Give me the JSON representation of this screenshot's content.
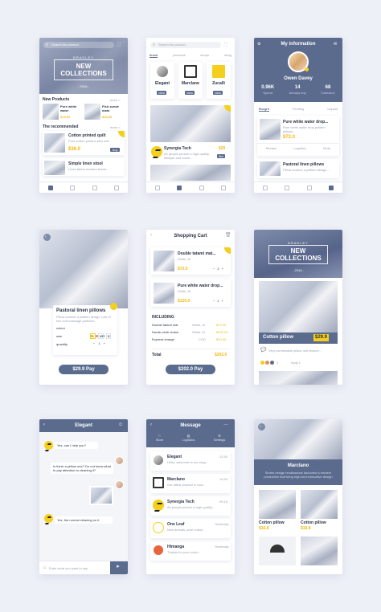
{
  "s1": {
    "search_placeholder": "Search the product",
    "brand": "BRADLEY",
    "collection_line1": "NEW",
    "collection_line2": "COLLECTIONS",
    "year": "- 2016 -",
    "new_products": "New Products",
    "more": "more >",
    "p1_name": "Pure white water",
    "p1_price": "$74.00",
    "p2_name": "Fish suede mats",
    "p2_price": "$12.00",
    "recommended": "The recommended",
    "r1_name": "Cotton printed quilt",
    "r1_desc": "Pure cotton printed ultra soft...",
    "r1_price": "$36.0",
    "r1_buy": "buy",
    "r2_name": "Simple linen stool",
    "r2_desc": "Linen fabric wooden frame..."
  },
  "s2": {
    "search_placeholder": "Search the product",
    "tabs": [
      "brand",
      "personal",
      "shops",
      "living"
    ],
    "b1": "Elegant",
    "b2": "Marclano",
    "b3": "Zucalli",
    "view": "view",
    "shop_name": "Synergia Tech",
    "shop_desc": "As people pursue a high-quality lifestyle and home...",
    "shop_price": "$20",
    "shop_btn": "like"
  },
  "s3": {
    "title": "My information",
    "name": "Owen Davey",
    "stat1_val": "0.96K",
    "stat1_lbl": "Spend",
    "stat2_val": "14",
    "stat2_lbl": "Already buy",
    "stat3_val": "68",
    "stat3_lbl": "Collection",
    "tabs": [
      "Bought",
      "Pending",
      "Unpaid"
    ],
    "o1_name": "Pure white water drop...",
    "o1_desc": "Pure white water drop pattern pillows...",
    "o1_price": "$72.0",
    "o1_actions": [
      "Review",
      "Logistics",
      "More"
    ],
    "o2_name": "Pastoral linen pillows",
    "o2_desc": "Pillow surface a pattern design..."
  },
  "s4": {
    "name": "Pastoral linen pillows",
    "desc": "Pillow surface a pattern design Lots of fine soft massage particles",
    "colour": "colour",
    "size": "size",
    "quantity": "quantity",
    "sizes": [
      "S",
      "M",
      "L"
    ],
    "qty": "1",
    "pay": "$29.9 Pay"
  },
  "s5": {
    "title": "Shopping Cart",
    "i1_name": "Double tatami mat...",
    "i1_sub": "White, M",
    "i1_price": "$72.0",
    "i1_qty": "2",
    "i2_name": "Pure white water drop...",
    "i2_sub": "White, M",
    "i2_price": "$120.0",
    "i2_qty": "1",
    "including": "INCLUDING",
    "rows": [
      {
        "name": "Double tatami mat",
        "opt": "White, M",
        "price": "$72.00"
      },
      {
        "name": "Nordic cloth chairs",
        "opt": "White, M",
        "price": "$120.00"
      },
      {
        "name": "Express charge",
        "opt": "COD",
        "price": "$10.00"
      }
    ],
    "total_lbl": "Total",
    "total_val": "$202.0",
    "pay": "$202.0  Pay"
  },
  "s6": {
    "brand": "BRADLEY",
    "line1": "NEW",
    "line2": "COLLECTIONS",
    "year": "- 2016 -",
    "item": "Cotton pillow",
    "price": "$29.9",
    "comment": "Very comfortable pillow, soft texture...",
    "likes": "2",
    "reply": "reply 1"
  },
  "s7": {
    "title": "Elegant",
    "m1": "Yes, can I help you?",
    "m2": "Is there a yellow one? Do not know what to pay attention to cleaning it?",
    "m3": "Yes, the normal cleaning on it",
    "input_placeholder": "Enter what you want to say"
  },
  "s8": {
    "title": "Message",
    "nav": [
      "Store",
      "Logistics",
      "Settings"
    ],
    "list": [
      {
        "name": "Elegant",
        "desc": "Hello, welcome to our shop...",
        "time": "12:30"
      },
      {
        "name": "Marclano",
        "desc": "Our latest product is now...",
        "time": "10:30"
      },
      {
        "name": "Synergia Tech",
        "desc": "As people pursue a high-quality...",
        "time": "09:15"
      },
      {
        "name": "One Leaf",
        "desc": "New arrivals, pure cotton...",
        "time": "Yesterday"
      },
      {
        "name": "Himanga",
        "desc": "Thanks for your order...",
        "time": "Yesterday"
      }
    ]
  },
  "s9": {
    "brand": "Marclano",
    "desc": "Stores design renaissance launched a modern production that bring high-end innovative design",
    "p1_name": "Cotton pillow",
    "p1_price": "$16.8",
    "p2_name": "Cotton pillow",
    "p2_price": "$16.8"
  },
  "colors": {
    "accent": "#5a6b8e",
    "highlight": "#f5cf1d",
    "price": "#f5b70f",
    "background": "#eef0f7"
  }
}
